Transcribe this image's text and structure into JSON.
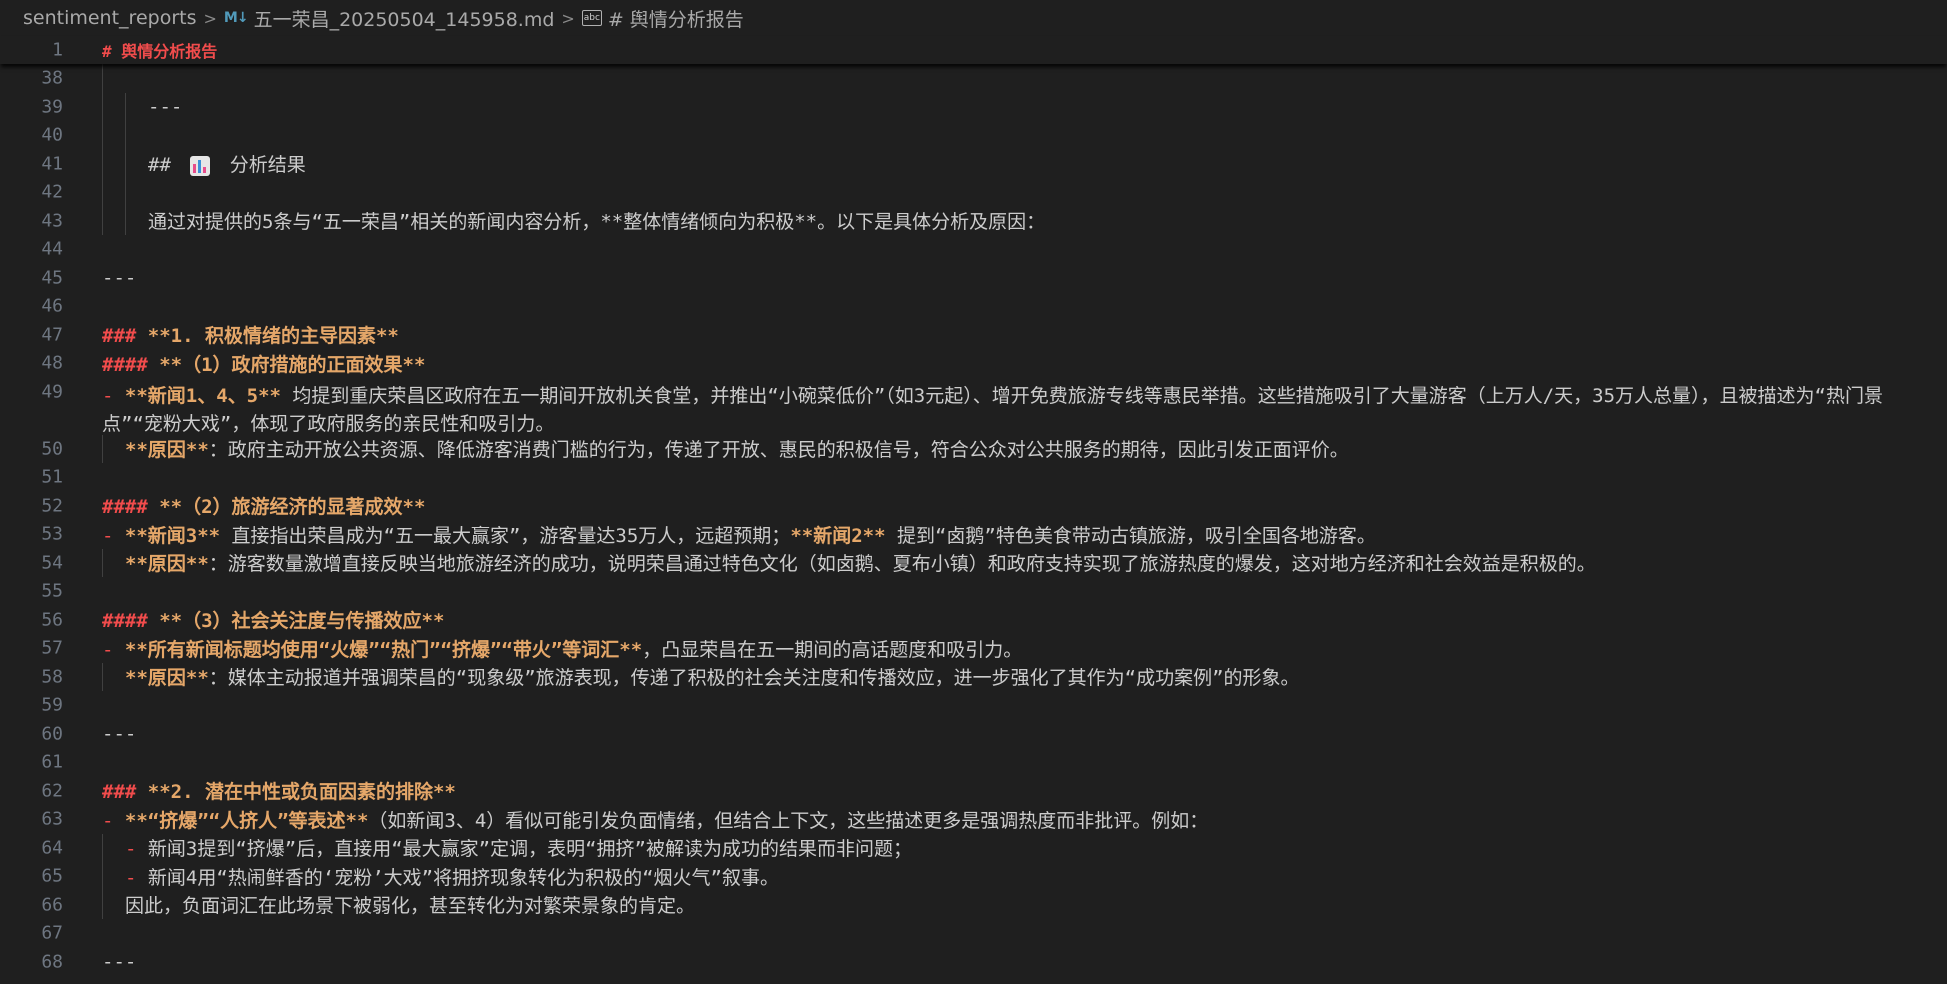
{
  "breadcrumb": {
    "folder": "sentiment_reports",
    "file": "五一荣昌_20250504_145958.md",
    "symbol": "# 舆情分析报告",
    "md_icon": "M↓",
    "symbol_icon": "abc"
  },
  "sticky": {
    "num": "1",
    "hash": "#",
    "text": "舆情分析报告"
  },
  "lines": {
    "l38": {
      "num": "38"
    },
    "l39": {
      "num": "39",
      "text": "---"
    },
    "l40": {
      "num": "40"
    },
    "l41": {
      "num": "41",
      "hash": "##",
      "text": "分析结果"
    },
    "l42": {
      "num": "42"
    },
    "l43": {
      "num": "43",
      "text": "通过对提供的5条与“五一荣昌”相关的新闻内容分析，**整体情绪倾向为积极**。以下是具体分析及原因："
    },
    "l44": {
      "num": "44"
    },
    "l45": {
      "num": "45",
      "text": "---"
    },
    "l46": {
      "num": "46"
    },
    "l47": {
      "num": "47",
      "hash": "###",
      "text": "**1. 积极情绪的主导因素**"
    },
    "l48": {
      "num": "48",
      "hash": "####",
      "text": "**（1）政府措施的正面效果**"
    },
    "l49": {
      "num": "49",
      "dash": "-",
      "bold": "**新闻1、4、5**",
      "text": " 均提到重庆荣昌区政府在五一期间开放机关食堂，并推出“小碗菜低价”（如3元起）、增开免费旅游专线等惠民举措。这些措施吸引了大量游客（上万人/天，35万人总量），且被描述为“热门景点”“宠粉大戏”，体现了政府服务的亲民性和吸引力。"
    },
    "l50": {
      "num": "50",
      "bold": "**原因**",
      "text": "：政府主动开放公共资源、降低游客消费门槛的行为，传递了开放、惠民的积极信号，符合公众对公共服务的期待，因此引发正面评价。"
    },
    "l51": {
      "num": "51"
    },
    "l52": {
      "num": "52",
      "hash": "####",
      "text": "**（2）旅游经济的显著成效**"
    },
    "l53": {
      "num": "53",
      "dash": "-",
      "bold": "**新闻3**",
      "text": " 直接指出荣昌成为“五一最大赢家”，游客量达35万人，远超预期；",
      "bold2": "**新闻2**",
      "text2": " 提到“卤鹅”特色美食带动古镇旅游，吸引全国各地游客。"
    },
    "l54": {
      "num": "54",
      "bold": "**原因**",
      "text": "：游客数量激增直接反映当地旅游经济的成功，说明荣昌通过特色文化（如卤鹅、夏布小镇）和政府支持实现了旅游热度的爆发，这对地方经济和社会效益是积极的。"
    },
    "l55": {
      "num": "55"
    },
    "l56": {
      "num": "56",
      "hash": "####",
      "text": "**（3）社会关注度与传播效应**"
    },
    "l57": {
      "num": "57",
      "dash": "-",
      "bold": "**所有新闻标题均使用“火爆”“热门”“挤爆”“带火”等词汇**",
      "text": "，凸显荣昌在五一期间的高话题度和吸引力。"
    },
    "l58": {
      "num": "58",
      "bold": "**原因**",
      "text": "：媒体主动报道并强调荣昌的“现象级”旅游表现，传递了积极的社会关注度和传播效应，进一步强化了其作为“成功案例”的形象。"
    },
    "l59": {
      "num": "59"
    },
    "l60": {
      "num": "60",
      "text": "---"
    },
    "l61": {
      "num": "61"
    },
    "l62": {
      "num": "62",
      "hash": "###",
      "text": "**2. 潜在中性或负面因素的排除**"
    },
    "l63": {
      "num": "63",
      "dash": "-",
      "bold": "**“挤爆”“人挤人”等表述**",
      "text": "（如新闻3、4）看似可能引发负面情绪，但结合上下文，这些描述更多是强调热度而非批评。例如："
    },
    "l64": {
      "num": "64",
      "dash": "-",
      "text": "新闻3提到“挤爆”后，直接用“最大赢家”定调，表明“拥挤”被解读为成功的结果而非问题；"
    },
    "l65": {
      "num": "65",
      "dash": "-",
      "text": "新闻4用“热闹鲜香的‘宠粉’大戏”将拥挤现象转化为积极的“烟火气”叙事。"
    },
    "l66": {
      "num": "66",
      "text": "因此，负面词汇在此场景下被弱化，甚至转化为对繁荣景象的肯定。"
    },
    "l67": {
      "num": "67"
    },
    "l68": {
      "num": "68",
      "text": "---"
    }
  },
  "colors": {
    "background": "#1f1f1f",
    "line_number": "#6e7681",
    "heading_hash": "#f14c4c",
    "bold_text": "#e5a769",
    "plain_text": "#cccccc"
  }
}
